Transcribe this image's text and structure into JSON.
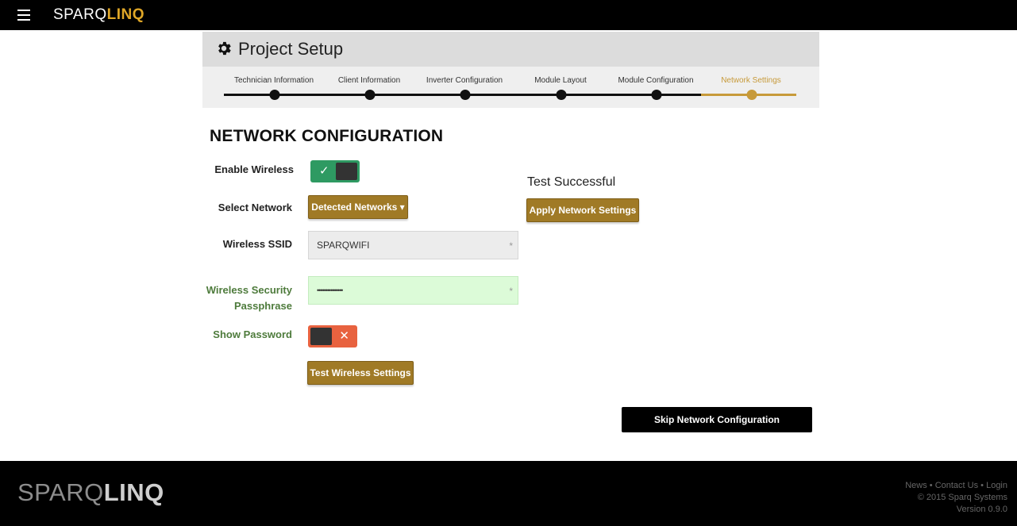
{
  "header": {
    "brand_part1": "SPARQ",
    "brand_part2": "LINQ"
  },
  "setup": {
    "title": "Project Setup",
    "steps": [
      {
        "label": "Technician Information",
        "state": "done"
      },
      {
        "label": "Client Information",
        "state": "done"
      },
      {
        "label": "Inverter Configuration",
        "state": "done"
      },
      {
        "label": "Module Layout",
        "state": "done"
      },
      {
        "label": "Module Configuration",
        "state": "done"
      },
      {
        "label": "Network Settings",
        "state": "active"
      }
    ]
  },
  "page": {
    "heading": "NETWORK CONFIGURATION"
  },
  "form": {
    "enable_wireless_label": "Enable Wireless",
    "enable_wireless_state": true,
    "enable_wireless_symbol": "✓",
    "select_network_label": "Select Network",
    "detected_networks_button": "Detected Networks ▾",
    "ssid_label": "Wireless SSID",
    "ssid_value": "SPARQWIFI",
    "passphrase_label_1": "Wireless Security",
    "passphrase_label_2": "Passphrase",
    "passphrase_value": "•••••••••••••••",
    "show_password_label": "Show Password",
    "show_password_state": false,
    "show_password_symbol": "✕",
    "test_button": "Test Wireless Settings",
    "required_marker": "*"
  },
  "result": {
    "status": "Test Successful",
    "apply_button": "Apply Network Settings"
  },
  "skip_button": "Skip Network Configuration",
  "footer": {
    "brand_part1": "SPARQ",
    "brand_part2": "LINQ",
    "link_news": "News",
    "link_contact": "Contact Us",
    "link_login": "Login",
    "separator": " • ",
    "copyright": "© 2015 Sparq Systems",
    "version": "Version 0.9.0"
  },
  "colors": {
    "gold": "#a07a26",
    "active_step": "#c79a3a",
    "toggle_on": "#2e9a62",
    "toggle_off": "#e8623f",
    "passphrase_bg": "#dcfbd8",
    "ssid_bg": "#ececec"
  },
  "icons": {
    "menu": "hamburger-icon",
    "settings": "gear-icon"
  }
}
